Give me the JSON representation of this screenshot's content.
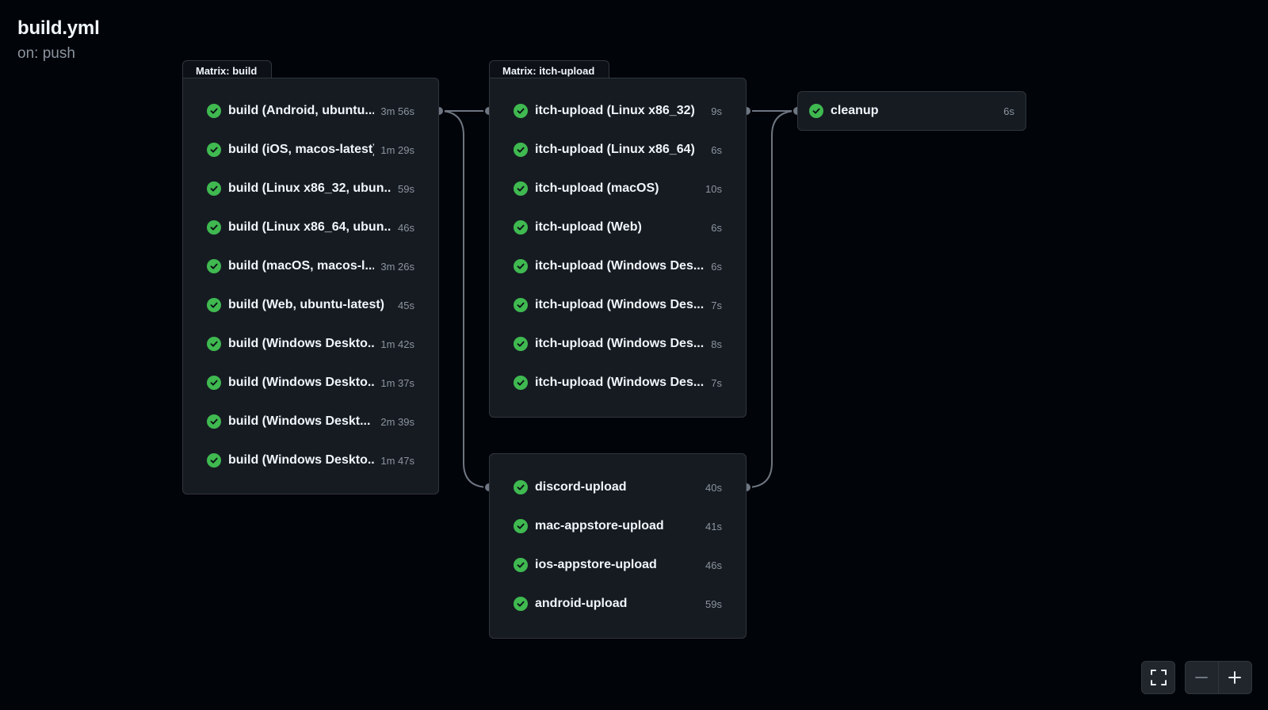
{
  "header": {
    "title": "build.yml",
    "subtitle": "on: push"
  },
  "groups": {
    "build": {
      "tab": "Matrix: build",
      "jobs": [
        {
          "name": "build (Android, ubuntu...",
          "time": "3m 56s"
        },
        {
          "name": "build (iOS, macos-latest)",
          "time": "1m 29s"
        },
        {
          "name": "build (Linux x86_32, ubun...",
          "time": "59s"
        },
        {
          "name": "build (Linux x86_64, ubun...",
          "time": "46s"
        },
        {
          "name": "build (macOS, macos-l...",
          "time": "3m 26s"
        },
        {
          "name": "build (Web, ubuntu-latest)",
          "time": "45s"
        },
        {
          "name": "build (Windows Deskto...",
          "time": "1m 42s"
        },
        {
          "name": "build (Windows Deskto...",
          "time": "1m 37s"
        },
        {
          "name": "build (Windows Deskt...",
          "time": "2m 39s"
        },
        {
          "name": "build (Windows Deskto...",
          "time": "1m 47s"
        }
      ]
    },
    "itch": {
      "tab": "Matrix: itch-upload",
      "jobs": [
        {
          "name": "itch-upload (Linux x86_32)",
          "time": "9s"
        },
        {
          "name": "itch-upload (Linux x86_64)",
          "time": "6s"
        },
        {
          "name": "itch-upload (macOS)",
          "time": "10s"
        },
        {
          "name": "itch-upload (Web)",
          "time": "6s"
        },
        {
          "name": "itch-upload (Windows Des...",
          "time": "6s"
        },
        {
          "name": "itch-upload (Windows Des...",
          "time": "7s"
        },
        {
          "name": "itch-upload (Windows Des...",
          "time": "8s"
        },
        {
          "name": "itch-upload (Windows Des...",
          "time": "7s"
        }
      ]
    },
    "uploads": {
      "jobs": [
        {
          "name": "discord-upload",
          "time": "40s"
        },
        {
          "name": "mac-appstore-upload",
          "time": "41s"
        },
        {
          "name": "ios-appstore-upload",
          "time": "46s"
        },
        {
          "name": "android-upload",
          "time": "59s"
        }
      ]
    },
    "cleanup": {
      "jobs": [
        {
          "name": "cleanup",
          "time": "6s"
        }
      ]
    }
  },
  "status": "success",
  "colors": {
    "background": "#010409",
    "panel": "#161b22",
    "border": "#30363d",
    "success": "#3fb950",
    "connector": "#6e7681"
  },
  "icons": {
    "job_status": "check-circle-icon",
    "fullscreen": "fullscreen-icon",
    "zoom_out": "minus-icon",
    "zoom_in": "plus-icon"
  }
}
